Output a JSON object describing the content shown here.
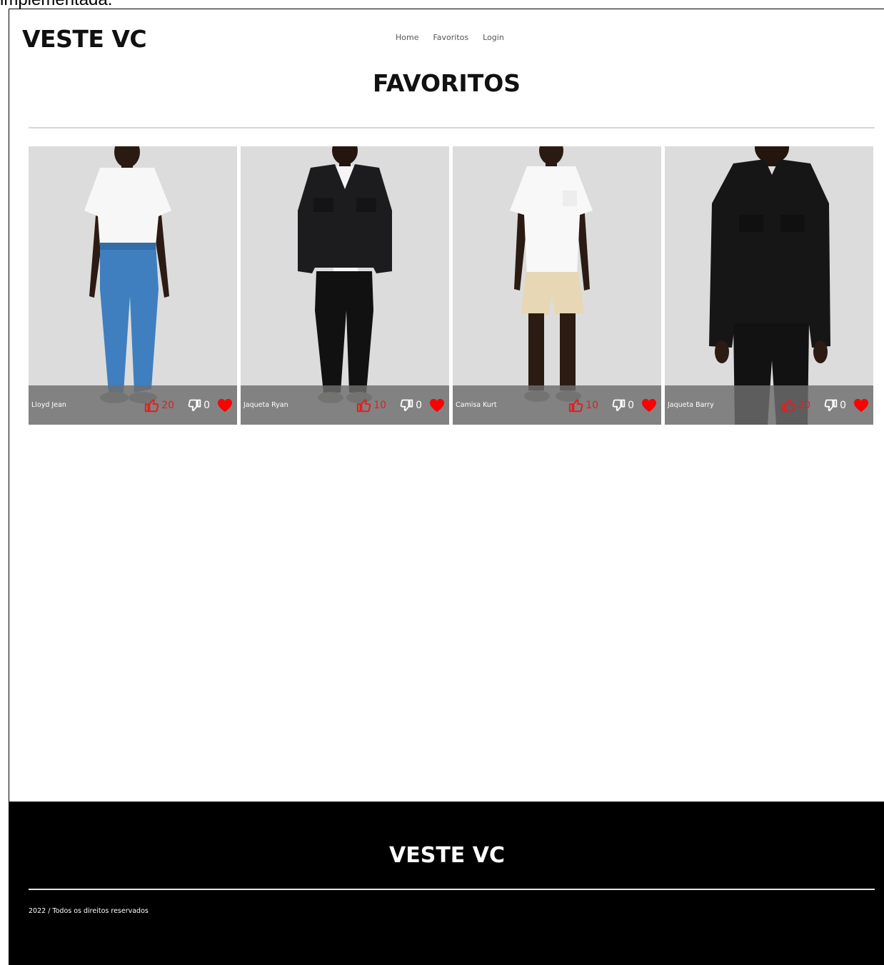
{
  "caption": "implementada.",
  "header": {
    "brand": "VESTE VC",
    "nav": [
      "Home",
      "Favoritos",
      "Login"
    ]
  },
  "page": {
    "title": "FAVORITOS"
  },
  "products": [
    {
      "name": "Lloyd Jean",
      "likes": "20",
      "dislikes": "0",
      "outfit": "white-tee-blue-jeans"
    },
    {
      "name": "Jaqueta Ryan",
      "likes": "10",
      "dislikes": "0",
      "outfit": "black-denim-jacket"
    },
    {
      "name": "Camisa Kurt",
      "likes": "10",
      "dislikes": "0",
      "outfit": "white-shirt-beige-shorts"
    },
    {
      "name": "Jaqueta Barry",
      "likes": "20",
      "dislikes": "0",
      "outfit": "black-overshirt"
    }
  ],
  "icons": {
    "like": "thumbs-up-icon",
    "dislike": "thumbs-down-icon",
    "favorite": "heart-icon"
  },
  "colors": {
    "like": "#e02020",
    "heart": "#ff0000",
    "footer_bg": "#000000",
    "card_bg": "#dcdcdc"
  },
  "footer": {
    "brand": "VESTE VC",
    "copyright": "2022 / Todos os direitos reservados"
  }
}
